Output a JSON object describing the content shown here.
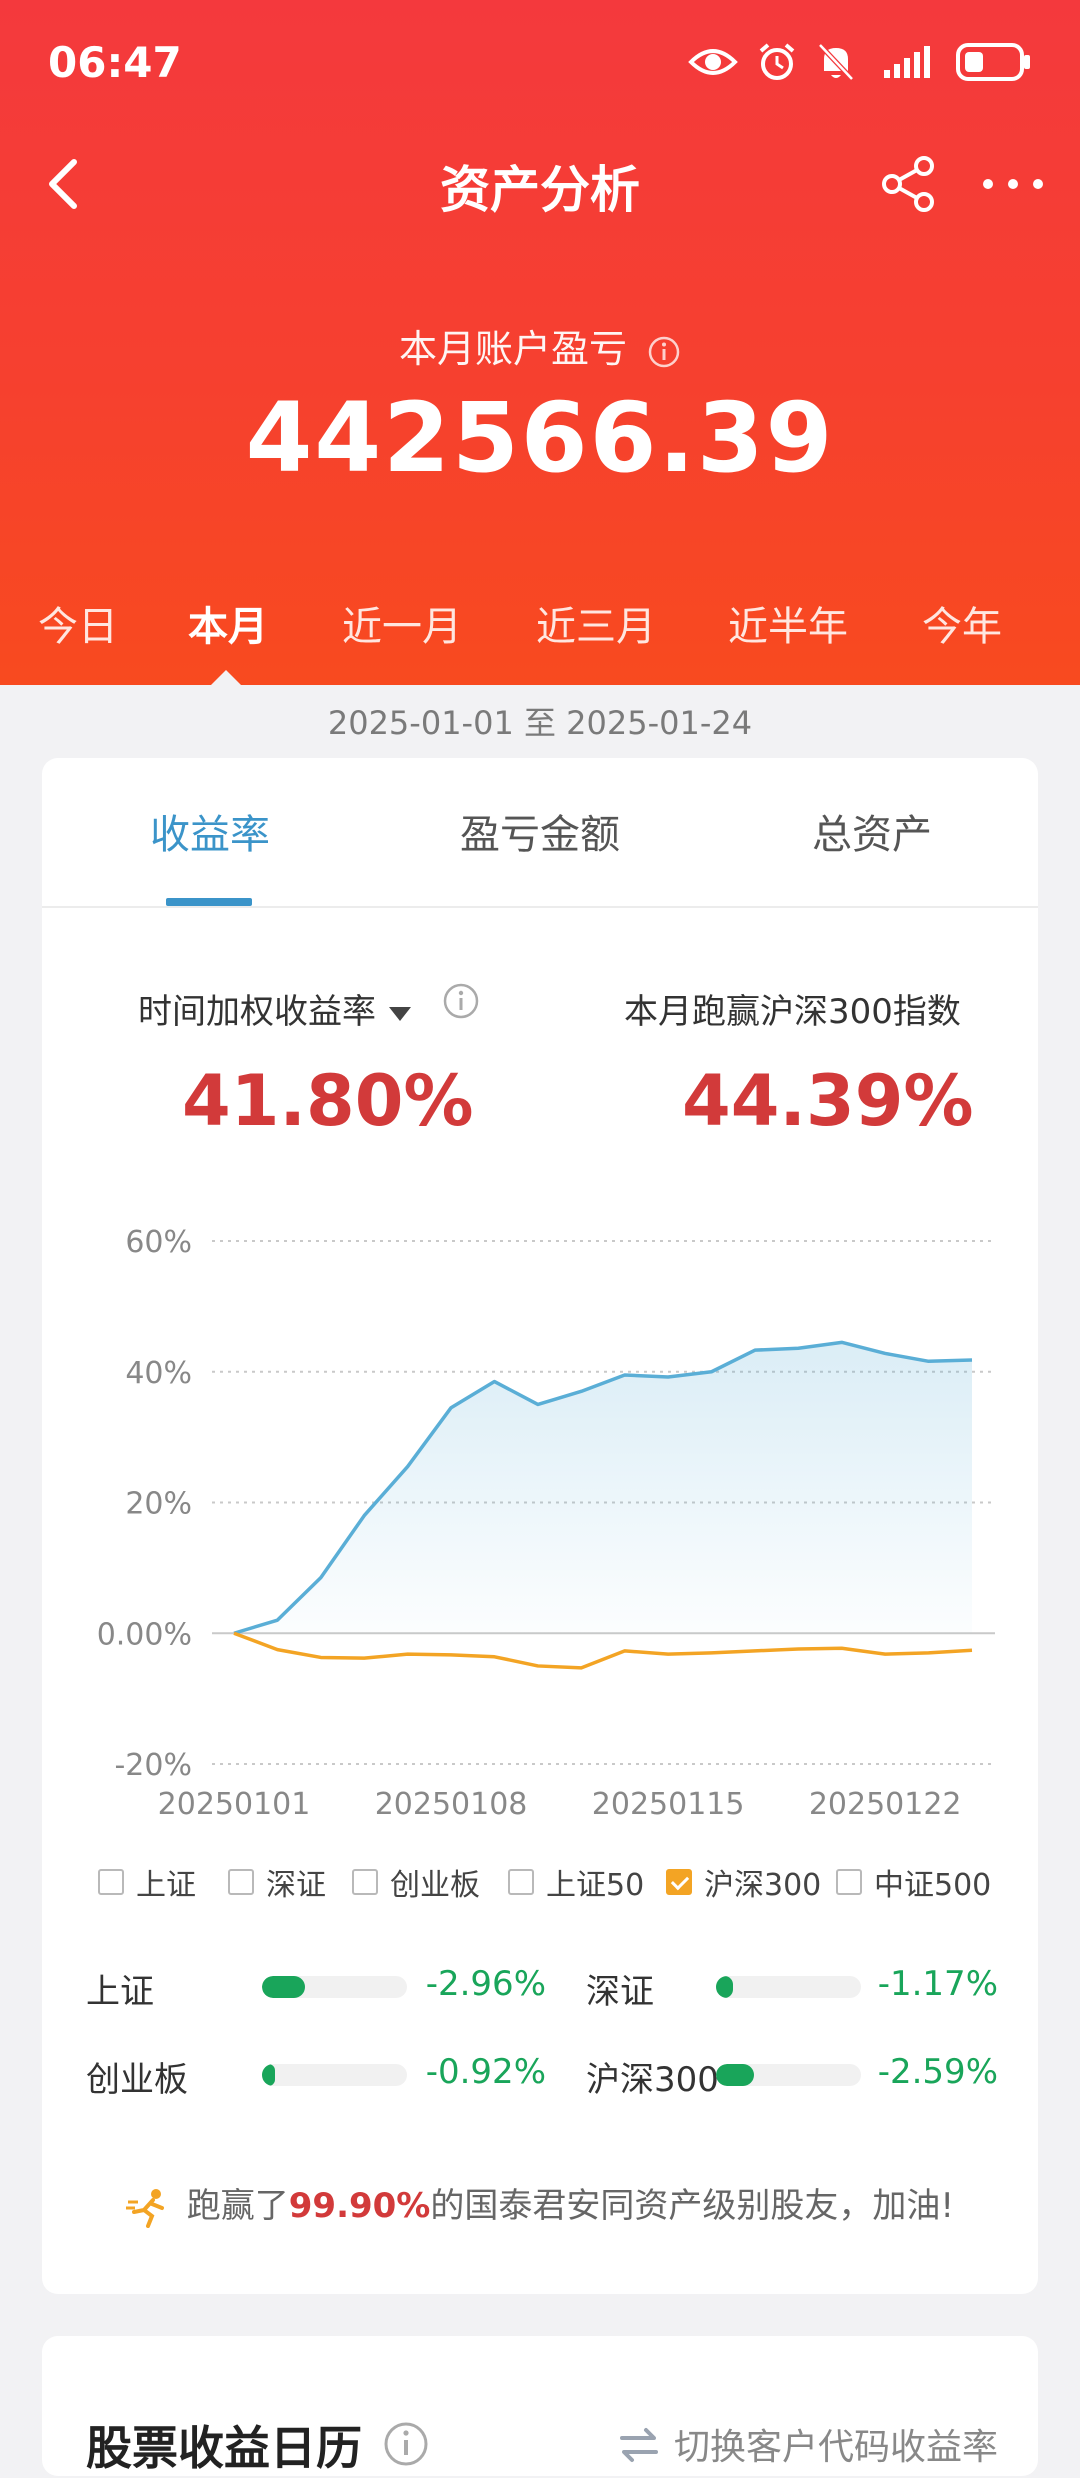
{
  "status_bar": {
    "time": "06:47"
  },
  "nav": {
    "title": "资产分析"
  },
  "summary": {
    "label": "本月账户盈亏",
    "value": "442566.39"
  },
  "period_tabs": [
    "今日",
    "本月",
    "近一月",
    "近三月",
    "近半年",
    "今年"
  ],
  "period_active": "本月",
  "date_range": "2025-01-01 至 2025-01-24",
  "metric_tabs": [
    "收益率",
    "盈亏金额",
    "总资产"
  ],
  "metric_active": "收益率",
  "stats": {
    "left_label": "时间加权收益率",
    "left_value": "41.80%",
    "right_label": "本月跑赢沪深300指数",
    "right_value": "44.39%"
  },
  "colors": {
    "header_red": "#f4393d",
    "accent_blue": "#3b94c9",
    "value_red": "#d23a3a",
    "down_green": "#19a55a",
    "index_orange": "#f3a424"
  },
  "chart_data": {
    "type": "line",
    "ylim": [
      -20,
      60
    ],
    "y_ticks": [
      "60%",
      "40%",
      "20%",
      "0.00%",
      "-20%"
    ],
    "y_tick_values": [
      60,
      40,
      20,
      0,
      -20
    ],
    "x_tick_labels": [
      "20250101",
      "20250108",
      "20250115",
      "20250122"
    ],
    "x_tick_positions": [
      0,
      5,
      10,
      15
    ],
    "grid": true,
    "series": [
      {
        "color": "#5aaed6",
        "area": true,
        "values": [
          0,
          2,
          8.5,
          18,
          25.5,
          34.5,
          38.5,
          35,
          37,
          39.5,
          39.2,
          40,
          43.3,
          43.6,
          44.5,
          42.8,
          41.6,
          41.8
        ]
      },
      {
        "color": "#f3a424",
        "area": false,
        "values": [
          0,
          -2.5,
          -3.7,
          -3.8,
          -3.2,
          -3.3,
          -3.6,
          -5,
          -5.3,
          -2.7,
          -3.2,
          -3,
          -2.7,
          -2.4,
          -2.3,
          -3.2,
          -3,
          -2.6
        ]
      }
    ]
  },
  "legend": [
    {
      "label": "上证",
      "checked": false
    },
    {
      "label": "深证",
      "checked": false
    },
    {
      "label": "创业板",
      "checked": false
    },
    {
      "label": "上证50",
      "checked": false
    },
    {
      "label": "沪深300",
      "checked": true
    },
    {
      "label": "中证500",
      "checked": false
    }
  ],
  "indices": [
    {
      "name": "上证",
      "value": "-2.96%",
      "pct": 2.96
    },
    {
      "name": "深证",
      "value": "-1.17%",
      "pct": 1.17
    },
    {
      "name": "创业板",
      "value": "-0.92%",
      "pct": 0.92
    },
    {
      "name": "沪深300",
      "value": "-2.59%",
      "pct": 2.59
    }
  ],
  "beat": {
    "prefix": "跑赢了",
    "pct": "99.90%",
    "suffix": "的国泰君安同资产级别股友，加油!"
  },
  "calendar": {
    "title": "股票收益日历",
    "switch_label": "切换客户代码收益率"
  }
}
